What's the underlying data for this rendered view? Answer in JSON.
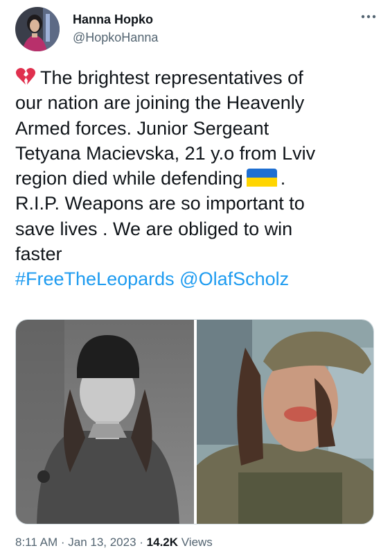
{
  "author": {
    "name": "Hanna Hopko",
    "handle": "@HopkoHanna"
  },
  "tweet": {
    "line1": "The brightest representatives of",
    "line2": "our nation are joining the Heavenly",
    "line3": "Armed forces. Junior Sergeant",
    "line4": "Tetyana Macievska, 21 y.o  from Lviv",
    "line5": "region died while defending",
    "line5_end": ".",
    "line6": "R.I.P.  Weapons are so important to",
    "line7": "save lives . We are obliged to win",
    "line8": "faster",
    "hashtag": "#FreeTheLeopards",
    "mention": "@OlafScholz",
    "emoji_start": "broken-heart-emoji",
    "emoji_inline": "ukraine-flag-emoji"
  },
  "meta": {
    "time": "8:11 AM",
    "sep1": " · ",
    "date": "Jan 13, 2023",
    "sep2": " · ",
    "views_count": "14.2K",
    "views_label": " Views"
  },
  "colors": {
    "link": "#1d9bf0",
    "text": "#0f1419",
    "secondary": "#536471",
    "heart": "#e0304e",
    "flag_blue": "#1f6fd1",
    "flag_yellow": "#ffd500"
  }
}
